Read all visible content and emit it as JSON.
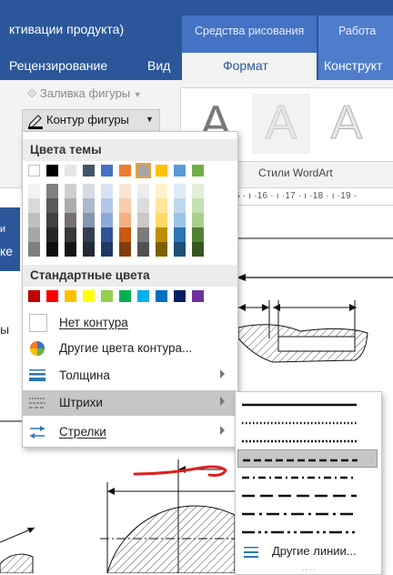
{
  "titlebar": {
    "title": "ктивации продукта)",
    "contexts": {
      "drawing": "Средства рисования",
      "work": "Работа"
    }
  },
  "tabs": {
    "review": "Рецензирование",
    "view": "Вид",
    "format": "Формат",
    "constructor": "Конструкт"
  },
  "ribbon": {
    "fill_label": "Заливка фигуры",
    "outline_label": "Контур фигуры",
    "wordart_group": "Стили WordArt",
    "wordart_glyph": "A",
    "ruler": "5 · ı ·16 · ı ·17 · ı ·18 · ı ·19 ·"
  },
  "left": {
    "blue_small": "и",
    "blue_big": "ке",
    "ui_text": "ы"
  },
  "dropdown": {
    "theme_header": "Цвета темы",
    "standard_header": "Стандартные цвета",
    "theme_base_colors": [
      "#ffffff",
      "#000000",
      "#e7e6e6",
      "#44546a",
      "#4472c4",
      "#ed7d31",
      "#a5a5a5",
      "#ffc000",
      "#5b9bd5",
      "#70ad47"
    ],
    "selected_theme_index": 6,
    "theme_shades": [
      [
        "#f2f2f2",
        "#d9d9d9",
        "#bfbfbf",
        "#a6a6a6",
        "#808080"
      ],
      [
        "#808080",
        "#595959",
        "#404040",
        "#262626",
        "#0d0d0d"
      ],
      [
        "#d0cece",
        "#aeabab",
        "#757171",
        "#3a3838",
        "#171616"
      ],
      [
        "#d6dce4",
        "#acb9ca",
        "#8496b0",
        "#333f4f",
        "#222a35"
      ],
      [
        "#d9e2f3",
        "#b4c6e7",
        "#8eaadb",
        "#2f5496",
        "#1f3864"
      ],
      [
        "#fbe5d5",
        "#f7cbac",
        "#f4b183",
        "#c55a11",
        "#833c0b"
      ],
      [
        "#ededed",
        "#dbdbdb",
        "#c9c9c9",
        "#7b7b7b",
        "#525252"
      ],
      [
        "#fff2cc",
        "#fee599",
        "#ffd965",
        "#bf8f00",
        "#7f6000"
      ],
      [
        "#deebf6",
        "#bdd7ee",
        "#9cc3e5",
        "#2e75b5",
        "#1e4e79"
      ],
      [
        "#e2efd9",
        "#c5e0b3",
        "#a8d08d",
        "#538135",
        "#375623"
      ]
    ],
    "standard_colors": [
      "#c00000",
      "#ff0000",
      "#ffc000",
      "#ffff00",
      "#92d050",
      "#00b050",
      "#00b0f0",
      "#0070c0",
      "#002060",
      "#7030a0"
    ],
    "no_outline": "Нет контура",
    "more_colors": "Другие цвета контура...",
    "weight": "Толщина",
    "dashes": "Штрихи",
    "arrows": "Стрелки"
  },
  "submenu": {
    "more_lines": "Другие линии...",
    "dash_patterns": [
      "solid",
      "round-dot",
      "square-dot",
      "dash",
      "dash-dot",
      "long-dash",
      "long-dash-dot",
      "long-dash-dot-dot"
    ],
    "selected_index": 3
  },
  "colors": {
    "ribbon_blue": "#2b579a",
    "context_blue": "#4472c4",
    "annotation_red": "#e02020"
  }
}
